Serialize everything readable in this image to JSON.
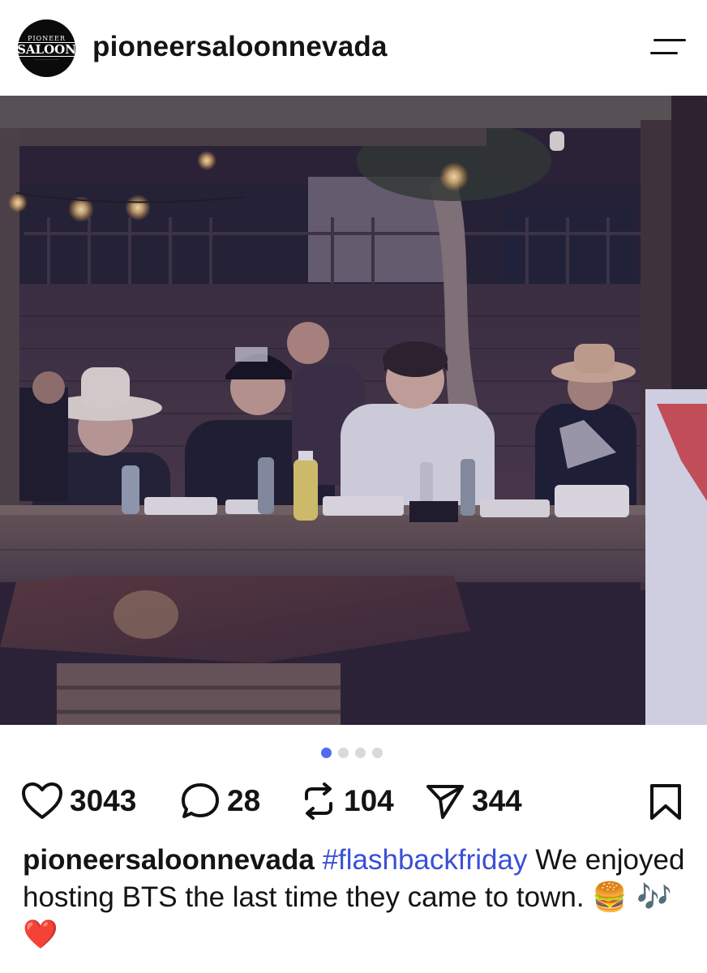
{
  "header": {
    "avatar": {
      "top_text": "PIONEER",
      "main_text": "SALOON"
    },
    "username": "pioneersaloonnevada"
  },
  "post": {
    "carousel": {
      "total": 4,
      "active_index": 0
    },
    "actions": {
      "likes": "3043",
      "comments": "28",
      "reposts": "104",
      "shares": "344"
    },
    "caption": {
      "username": "pioneersaloonnevada",
      "hashtag": "#flashbackfriday",
      "text": " We enjoyed hosting BTS the last time they came to town. ",
      "emojis": "🍔 🎶 ❤️"
    }
  },
  "colors": {
    "accent_blue": "#3a4fd7",
    "active_dot": "#4f6bf0",
    "inactive_dot": "#d9d9d9",
    "heart_red": "#e0242f"
  },
  "icons": [
    "menu-icon",
    "heart-icon",
    "comment-icon",
    "repost-icon",
    "share-icon",
    "bookmark-icon"
  ]
}
